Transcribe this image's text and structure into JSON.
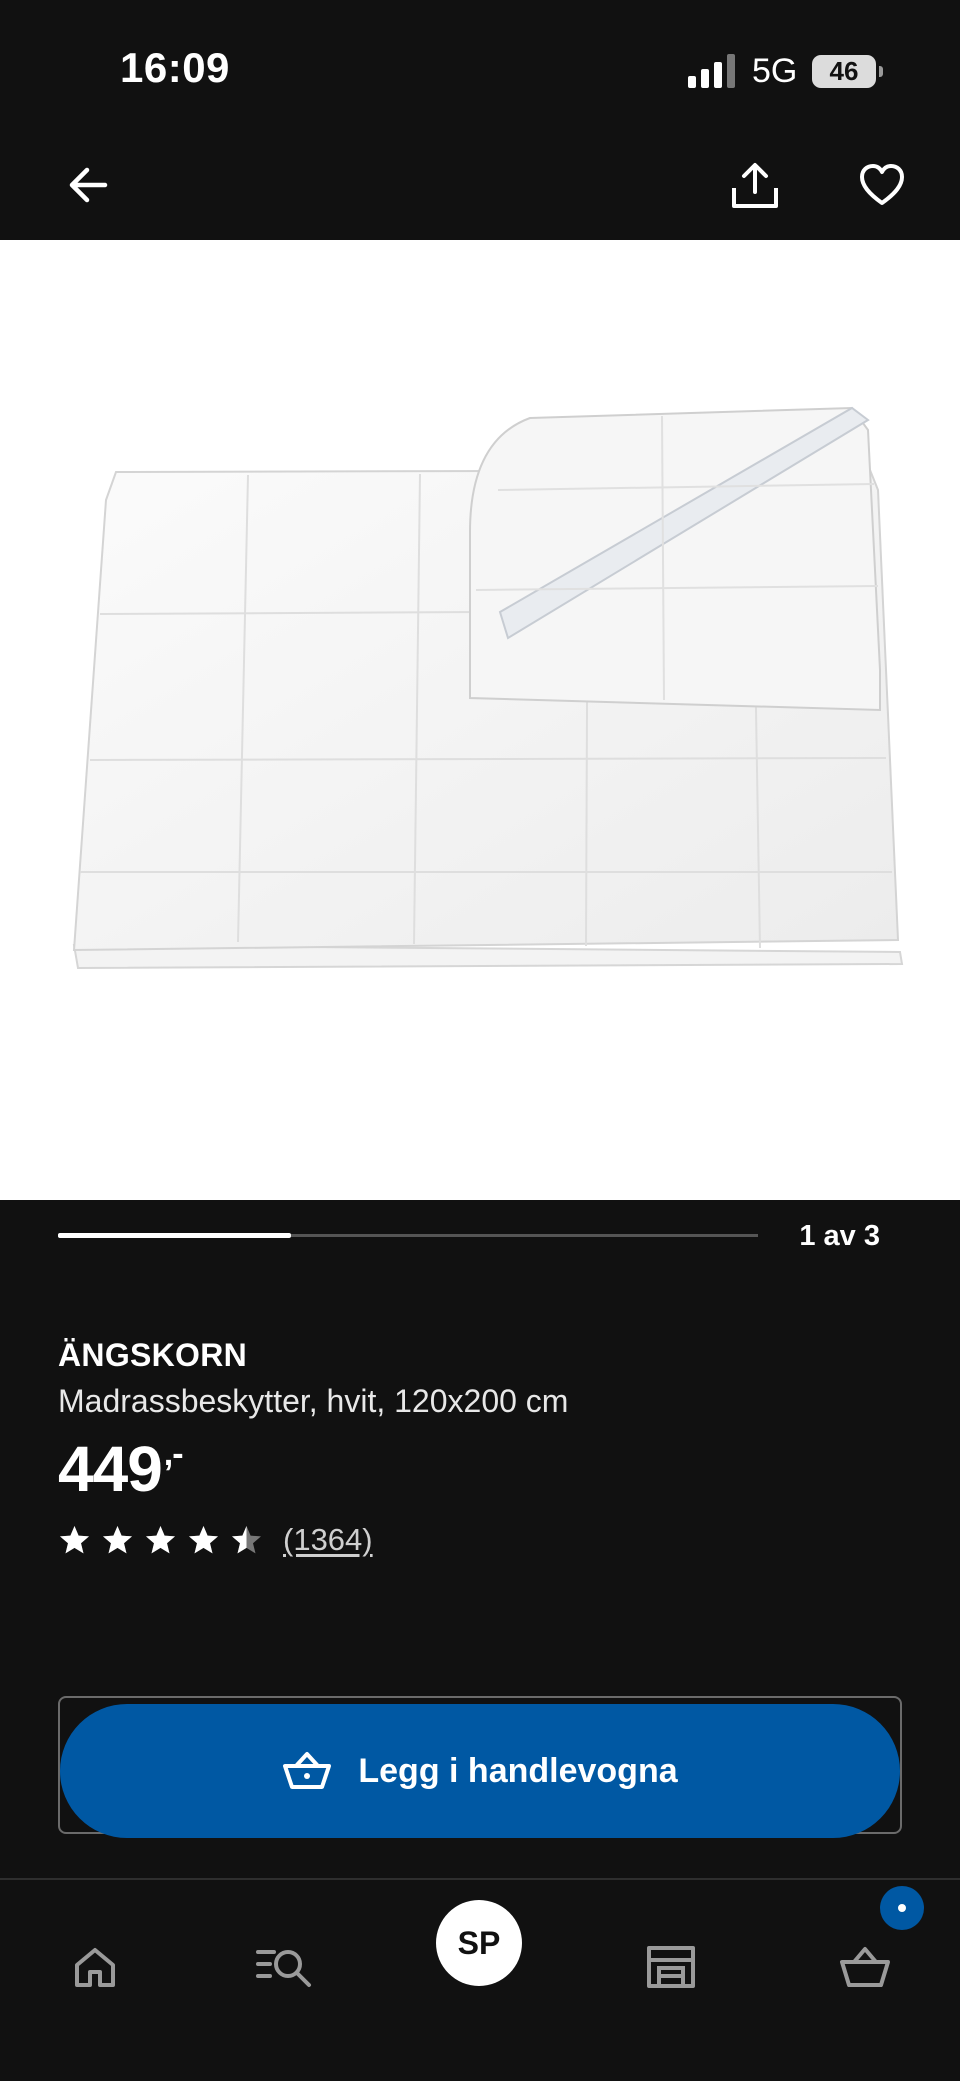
{
  "status_bar": {
    "time": "16:09",
    "network": "5G",
    "battery": "46"
  },
  "product": {
    "name": "ÄNGSKORN",
    "description": "Madrassbeskytter, hvit, 120x200 cm",
    "price": "449",
    "price_suffix": ",-",
    "rating": 4.5,
    "review_count": "(1364)"
  },
  "gallery": {
    "counter": "1 av 3",
    "progress": 0.333
  },
  "actions": {
    "add_to_cart_label": "Legg i handlevogna"
  },
  "bottom_nav": {
    "profile_initials": "SP"
  },
  "colors": {
    "background": "#111111",
    "accent": "#0058a3",
    "text": "#ffffff"
  }
}
